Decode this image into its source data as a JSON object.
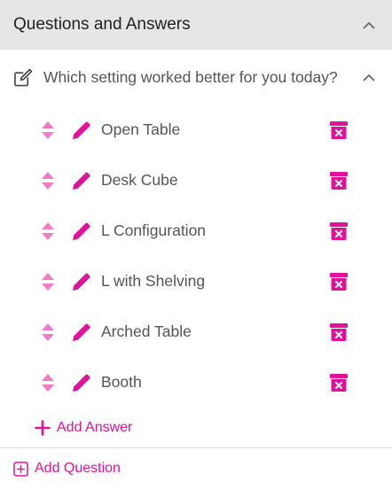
{
  "colors": {
    "accent": "#e0119a",
    "accent_light": "#f07cc8",
    "header_bg": "#e6e6e6",
    "text": "#555555",
    "divider": "#d8d8d8"
  },
  "panel": {
    "title": "Questions and Answers",
    "collapse_icon": "chevron-up-icon"
  },
  "question": {
    "text": "Which setting worked better for you today?",
    "edit_icon": "edit-square-icon",
    "collapse_icon": "chevron-up-icon"
  },
  "answers": [
    {
      "label": "Open Table"
    },
    {
      "label": "Desk Cube"
    },
    {
      "label": "L Configuration"
    },
    {
      "label": "L with Shelving"
    },
    {
      "label": "Arched Table"
    },
    {
      "label": "Booth"
    }
  ],
  "answer_icons": {
    "drag": "sort-handle-icon",
    "edit": "pencil-icon",
    "delete": "trash-box-icon"
  },
  "actions": {
    "add_answer": "Add Answer",
    "add_question": "Add Question"
  }
}
